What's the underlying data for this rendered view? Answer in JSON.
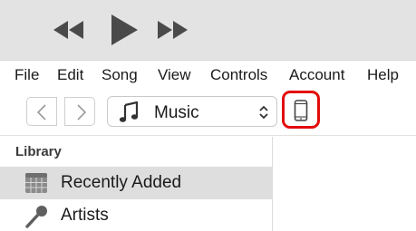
{
  "playback": {
    "rewind_icon": "rewind-icon",
    "play_icon": "play-icon",
    "fast_forward_icon": "fast-forward-icon"
  },
  "menu": {
    "items": [
      "File",
      "Edit",
      "Song",
      "View",
      "Controls",
      "Account",
      "Help"
    ]
  },
  "toolbar": {
    "back_icon": "chevron-left-icon",
    "forward_icon": "chevron-right-icon",
    "media_type": {
      "icon": "music-note-icon",
      "selected": "Music"
    },
    "device_icon": "iphone-icon",
    "device_highlight_color": "#e30b0b"
  },
  "sidebar": {
    "section_title": "Library",
    "items": [
      {
        "label": "Recently Added",
        "icon": "grid-icon",
        "selected": true
      },
      {
        "label": "Artists",
        "icon": "microphone-icon",
        "selected": false
      }
    ]
  },
  "colors": {
    "titlebar_bg": "#e3e3e3",
    "selected_row_bg": "#dedede",
    "highlight": "#e30b0b"
  }
}
